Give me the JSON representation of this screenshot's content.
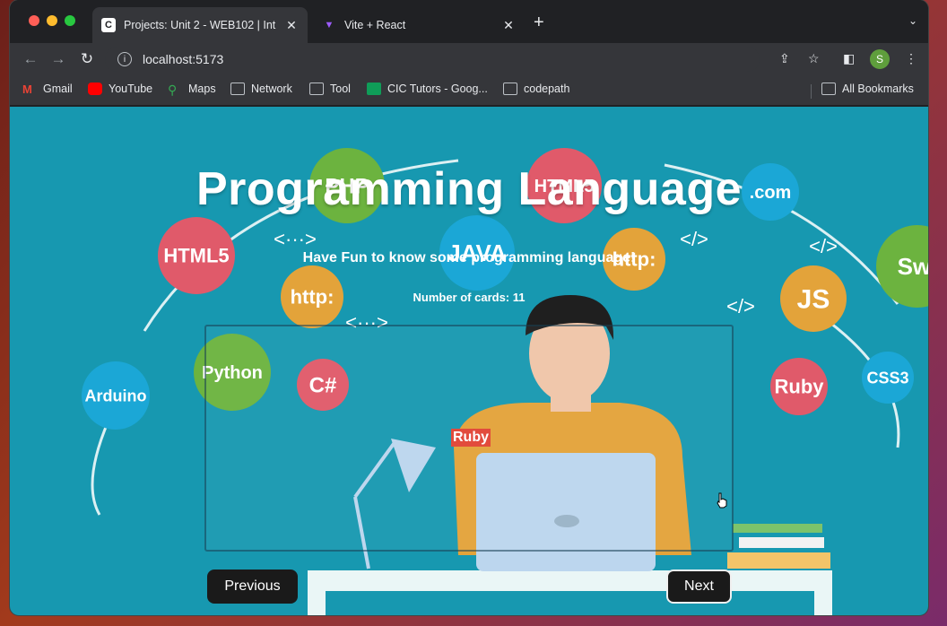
{
  "browser": {
    "tabs": [
      {
        "title": "Projects: Unit 2 - WEB102 | Int",
        "favicon": "codepath-icon",
        "active": true
      },
      {
        "title": "Vite + React",
        "favicon": "vite-icon",
        "active": false
      }
    ],
    "url": "localhost:5173",
    "profile_initial": "S",
    "bookmarks": [
      {
        "label": "Gmail",
        "icon": "gmail-icon"
      },
      {
        "label": "YouTube",
        "icon": "youtube-icon"
      },
      {
        "label": "Maps",
        "icon": "maps-icon"
      },
      {
        "label": "Network",
        "icon": "folder-icon"
      },
      {
        "label": "Tool",
        "icon": "folder-icon"
      },
      {
        "label": "CIC Tutors - Goog...",
        "icon": "sheets-icon"
      },
      {
        "label": "codepath",
        "icon": "folder-icon"
      }
    ],
    "all_bookmarks": "All Bookmarks"
  },
  "app": {
    "title": "Programming Language",
    "subtitle": "Have Fun to know some programming language!",
    "card_count_label": "Number of cards: 11",
    "card": {
      "label": "Ruby"
    },
    "buttons": {
      "previous": "Previous",
      "next": "Next"
    }
  },
  "background_bubbles": [
    {
      "text": "PHP",
      "color": "#6cb33f"
    },
    {
      "text": "HTML5",
      "color": "#e05a6a"
    },
    {
      "text": ".com",
      "color": "#1ba7d6"
    },
    {
      "text": "HTML5",
      "color": "#e05a6a"
    },
    {
      "text": "JAVA",
      "color": "#1ba7d6"
    },
    {
      "text": "http:",
      "color": "#e3a33a"
    },
    {
      "text": "Swi",
      "color": "#6cb33f"
    },
    {
      "text": "http:",
      "color": "#e3a33a"
    },
    {
      "text": "JS",
      "color": "#e3a33a"
    },
    {
      "text": "Python",
      "color": "#6cb33f"
    },
    {
      "text": "C#",
      "color": "#e05a6a"
    },
    {
      "text": "Arduino",
      "color": "#1ba7d6"
    },
    {
      "text": "Ruby",
      "color": "#e05a6a"
    },
    {
      "text": "CSS3",
      "color": "#1ba7d6"
    }
  ],
  "background_glyphs": [
    "<···>",
    "</>",
    "</>",
    "<···>",
    "</>"
  ],
  "colors": {
    "page_bg": "#1798b0",
    "button_bg": "#1a1a1a",
    "card_label_bg": "#e24b3c"
  }
}
